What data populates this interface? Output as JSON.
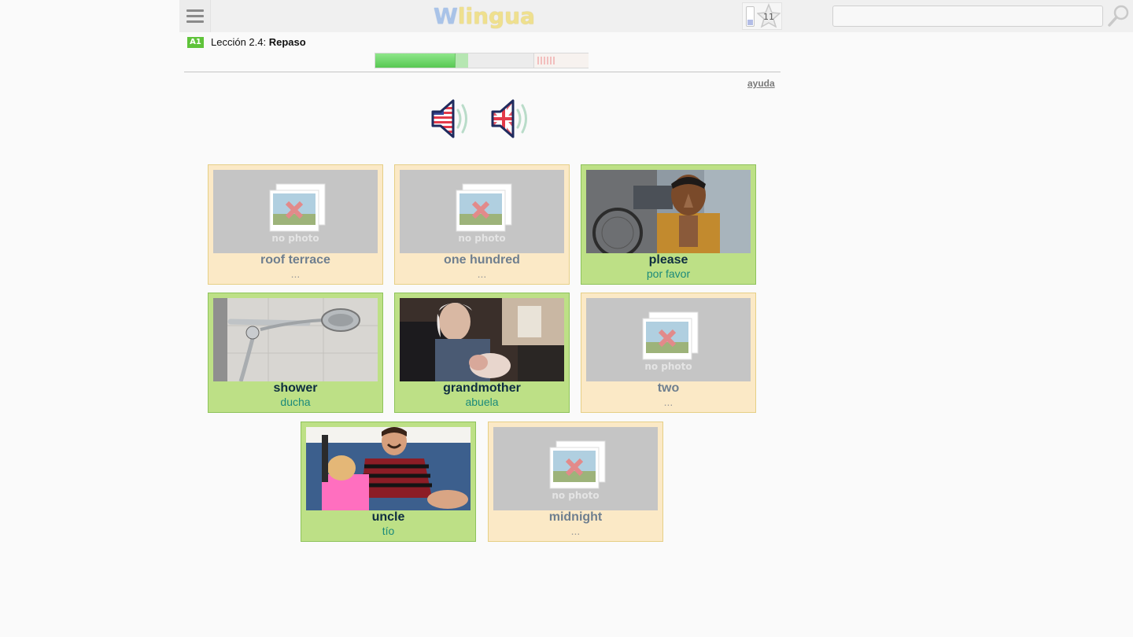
{
  "header": {
    "logo_w": "W",
    "logo_rest": "lingua",
    "star_count": "11",
    "search_placeholder": "",
    "icons": [
      "menu-icon",
      "phone-icon",
      "star-icon",
      "search-icon"
    ]
  },
  "lesson": {
    "level": "A1",
    "title_prefix": "Lección 2.4: ",
    "title_name": "Repaso",
    "progress_fraction": 0.43,
    "help": "ayuda"
  },
  "audio": {
    "buttons": [
      "us-speaker-icon",
      "uk-speaker-icon"
    ]
  },
  "cards": [
    {
      "word": "roof terrace",
      "translation": "...",
      "state": "unknown",
      "photo": "no photo"
    },
    {
      "word": "one hundred",
      "translation": "...",
      "state": "unknown",
      "photo": "no photo"
    },
    {
      "word": "please",
      "translation": "por favor",
      "state": "known",
      "photo": "boy-photo"
    },
    {
      "word": "shower",
      "translation": "ducha",
      "state": "known",
      "photo": "shower-photo"
    },
    {
      "word": "grandmother",
      "translation": "abuela",
      "state": "known",
      "photo": "grandmother-photo"
    },
    {
      "word": "two",
      "translation": "...",
      "state": "unknown",
      "photo": "no photo"
    },
    {
      "word": "uncle",
      "translation": "tío",
      "state": "known",
      "photo": "uncle-photo"
    },
    {
      "word": "midnight",
      "translation": "...",
      "state": "unknown",
      "photo": "no photo"
    }
  ],
  "colors": {
    "known_bg": "#bde086",
    "unknown_bg": "#fbe9c6",
    "level_badge": "#5fc33a",
    "progress": "#57c852"
  }
}
